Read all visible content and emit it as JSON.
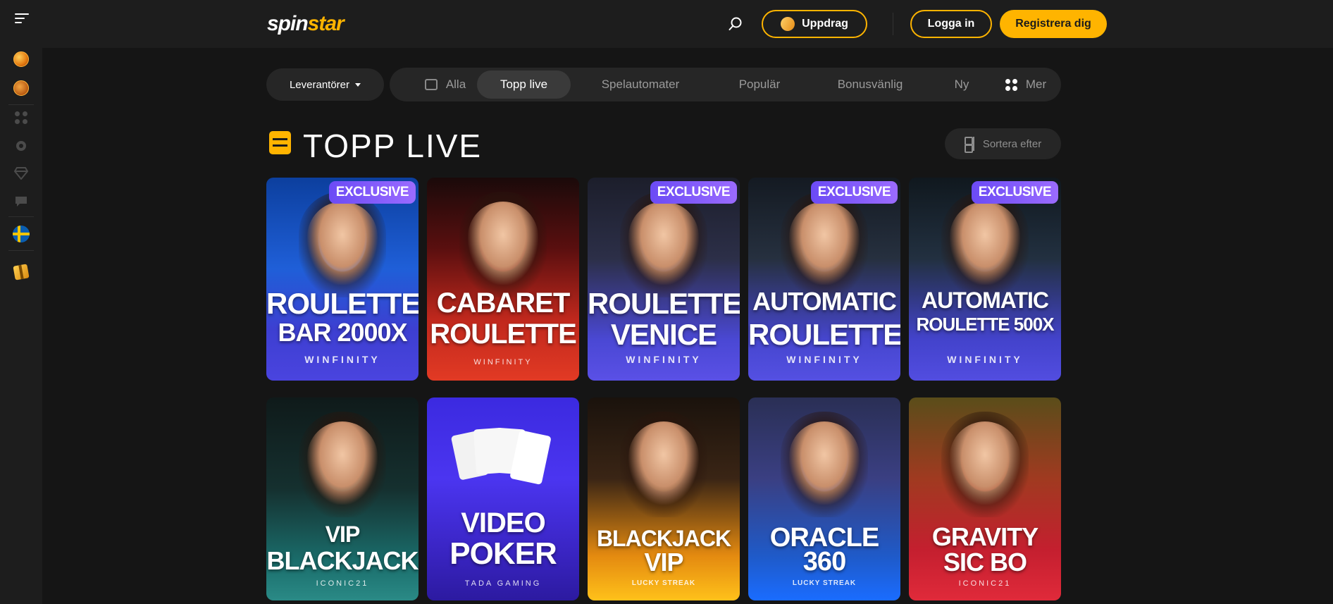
{
  "header": {
    "logo_spin": "spin",
    "logo_star": "star",
    "uppdrag_label": "Uppdrag",
    "login_label": "Logga in",
    "register_label": "Registrera dig",
    "accent_color": "#ffb400"
  },
  "filters": {
    "providers_label": "Leverantörer",
    "tabs": [
      {
        "label": "Alla",
        "icon": "grid-box-icon"
      },
      {
        "label": "Topp live",
        "active": true
      },
      {
        "label": "Spelautomater"
      },
      {
        "label": "Populär"
      },
      {
        "label": "Bonusvänlig"
      },
      {
        "label": "Ny"
      },
      {
        "label": "Mer",
        "icon": "dots-icon"
      }
    ]
  },
  "section": {
    "title": "TOPP LIVE",
    "sort_label": "Sortera efter"
  },
  "games": [
    {
      "line1": "ROULETTE",
      "line2": "BAR 2000X",
      "provider": "WINFINITY",
      "exclusive": "EXCLUSIVE"
    },
    {
      "line1": "CABARET",
      "line2": "ROULETTE",
      "provider": "WINFINITY",
      "exclusive": ""
    },
    {
      "line1": "ROULETTE",
      "line2": "VENICE",
      "provider": "WINFINITY",
      "exclusive": "EXCLUSIVE"
    },
    {
      "line1": "AUTOMATIC",
      "line2": "ROULETTE",
      "provider": "WINFINITY",
      "exclusive": "EXCLUSIVE"
    },
    {
      "line1": "AUTOMATIC",
      "line2": "ROULETTE 500X",
      "provider": "WINFINITY",
      "exclusive": "EXCLUSIVE"
    },
    {
      "line1": "VIP",
      "line2": "BLACKJACK",
      "provider": "ICONIC21",
      "exclusive": ""
    },
    {
      "line1": "VIDEO",
      "line2": "POKER",
      "provider": "TADA GAMING",
      "exclusive": ""
    },
    {
      "line1": "BLACKJACK",
      "line2": "VIP",
      "provider": "LUCKY STREAK",
      "exclusive": ""
    },
    {
      "line1": "ORACLE",
      "line2": "360",
      "provider": "LUCKY STREAK",
      "exclusive": ""
    },
    {
      "line1": "GRAVITY",
      "line2": "SIC BO",
      "provider": "ICONIC21",
      "exclusive": ""
    }
  ],
  "sidebar": {
    "items": [
      "coin-icon",
      "cookie-icon",
      "dots-icon",
      "gear-badge-icon",
      "diamond-icon",
      "chat-icon",
      "sweden-flag-icon",
      "gift-icon"
    ]
  }
}
